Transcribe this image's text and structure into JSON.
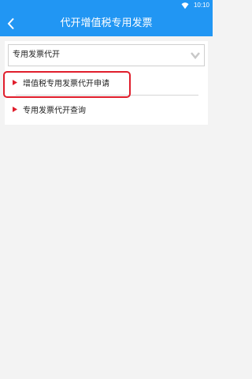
{
  "status_bar": {
    "time": "10:10",
    "icons": [
      "wifi-icon"
    ],
    "color": "#2196f3"
  },
  "app_bar": {
    "title": "代开增值税专用发票",
    "back_icon": "back-arrow-icon",
    "background": "#2196f3"
  },
  "selector": {
    "value": "专用发票代开",
    "icon": "chevron-down-icon"
  },
  "menu": {
    "items": [
      {
        "label": "增值税专用发票代开申请",
        "icon": "triangle-right-icon",
        "highlighted": true
      },
      {
        "label": "专用发票代开查询",
        "icon": "triangle-right-icon",
        "highlighted": false
      }
    ]
  },
  "colors": {
    "accent": "#2196f3",
    "marker": "#e01e2c",
    "highlight": "#e01e2c",
    "background": "#f3f3f3"
  }
}
